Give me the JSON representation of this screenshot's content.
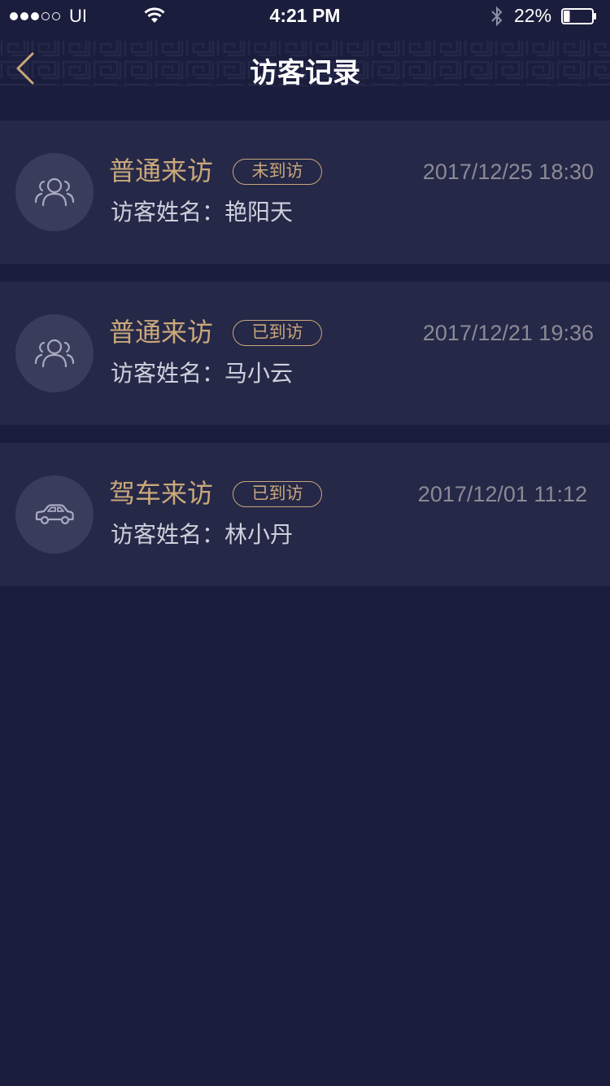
{
  "status_bar": {
    "carrier": "UI",
    "time": "4:21 PM",
    "battery_percent": "22%",
    "battery_level": 0.22,
    "signal_bars_filled": 3,
    "signal_bars_total": 5
  },
  "nav": {
    "title": "访客记录",
    "back_icon": "chevron-left-icon"
  },
  "colors": {
    "background": "#1b1d3c",
    "card": "#262848",
    "accent_gold": "#c9a87a",
    "muted_text": "#8c8a94"
  },
  "visits": [
    {
      "type": "普通来访",
      "status": "未到访",
      "time": "2017/12/25 18:30",
      "visitor_label": "访客姓名：",
      "visitor_name": "艳阳天",
      "icon": "people-icon"
    },
    {
      "type": "普通来访",
      "status": "已到访",
      "time": "2017/12/21 19:36",
      "visitor_label": "访客姓名：",
      "visitor_name": "马小云",
      "icon": "people-icon"
    },
    {
      "type": "驾车来访",
      "status": "已到访",
      "time": "2017/12/01 11:12",
      "visitor_label": "访客姓名：",
      "visitor_name": "林小丹",
      "icon": "car-icon"
    }
  ]
}
